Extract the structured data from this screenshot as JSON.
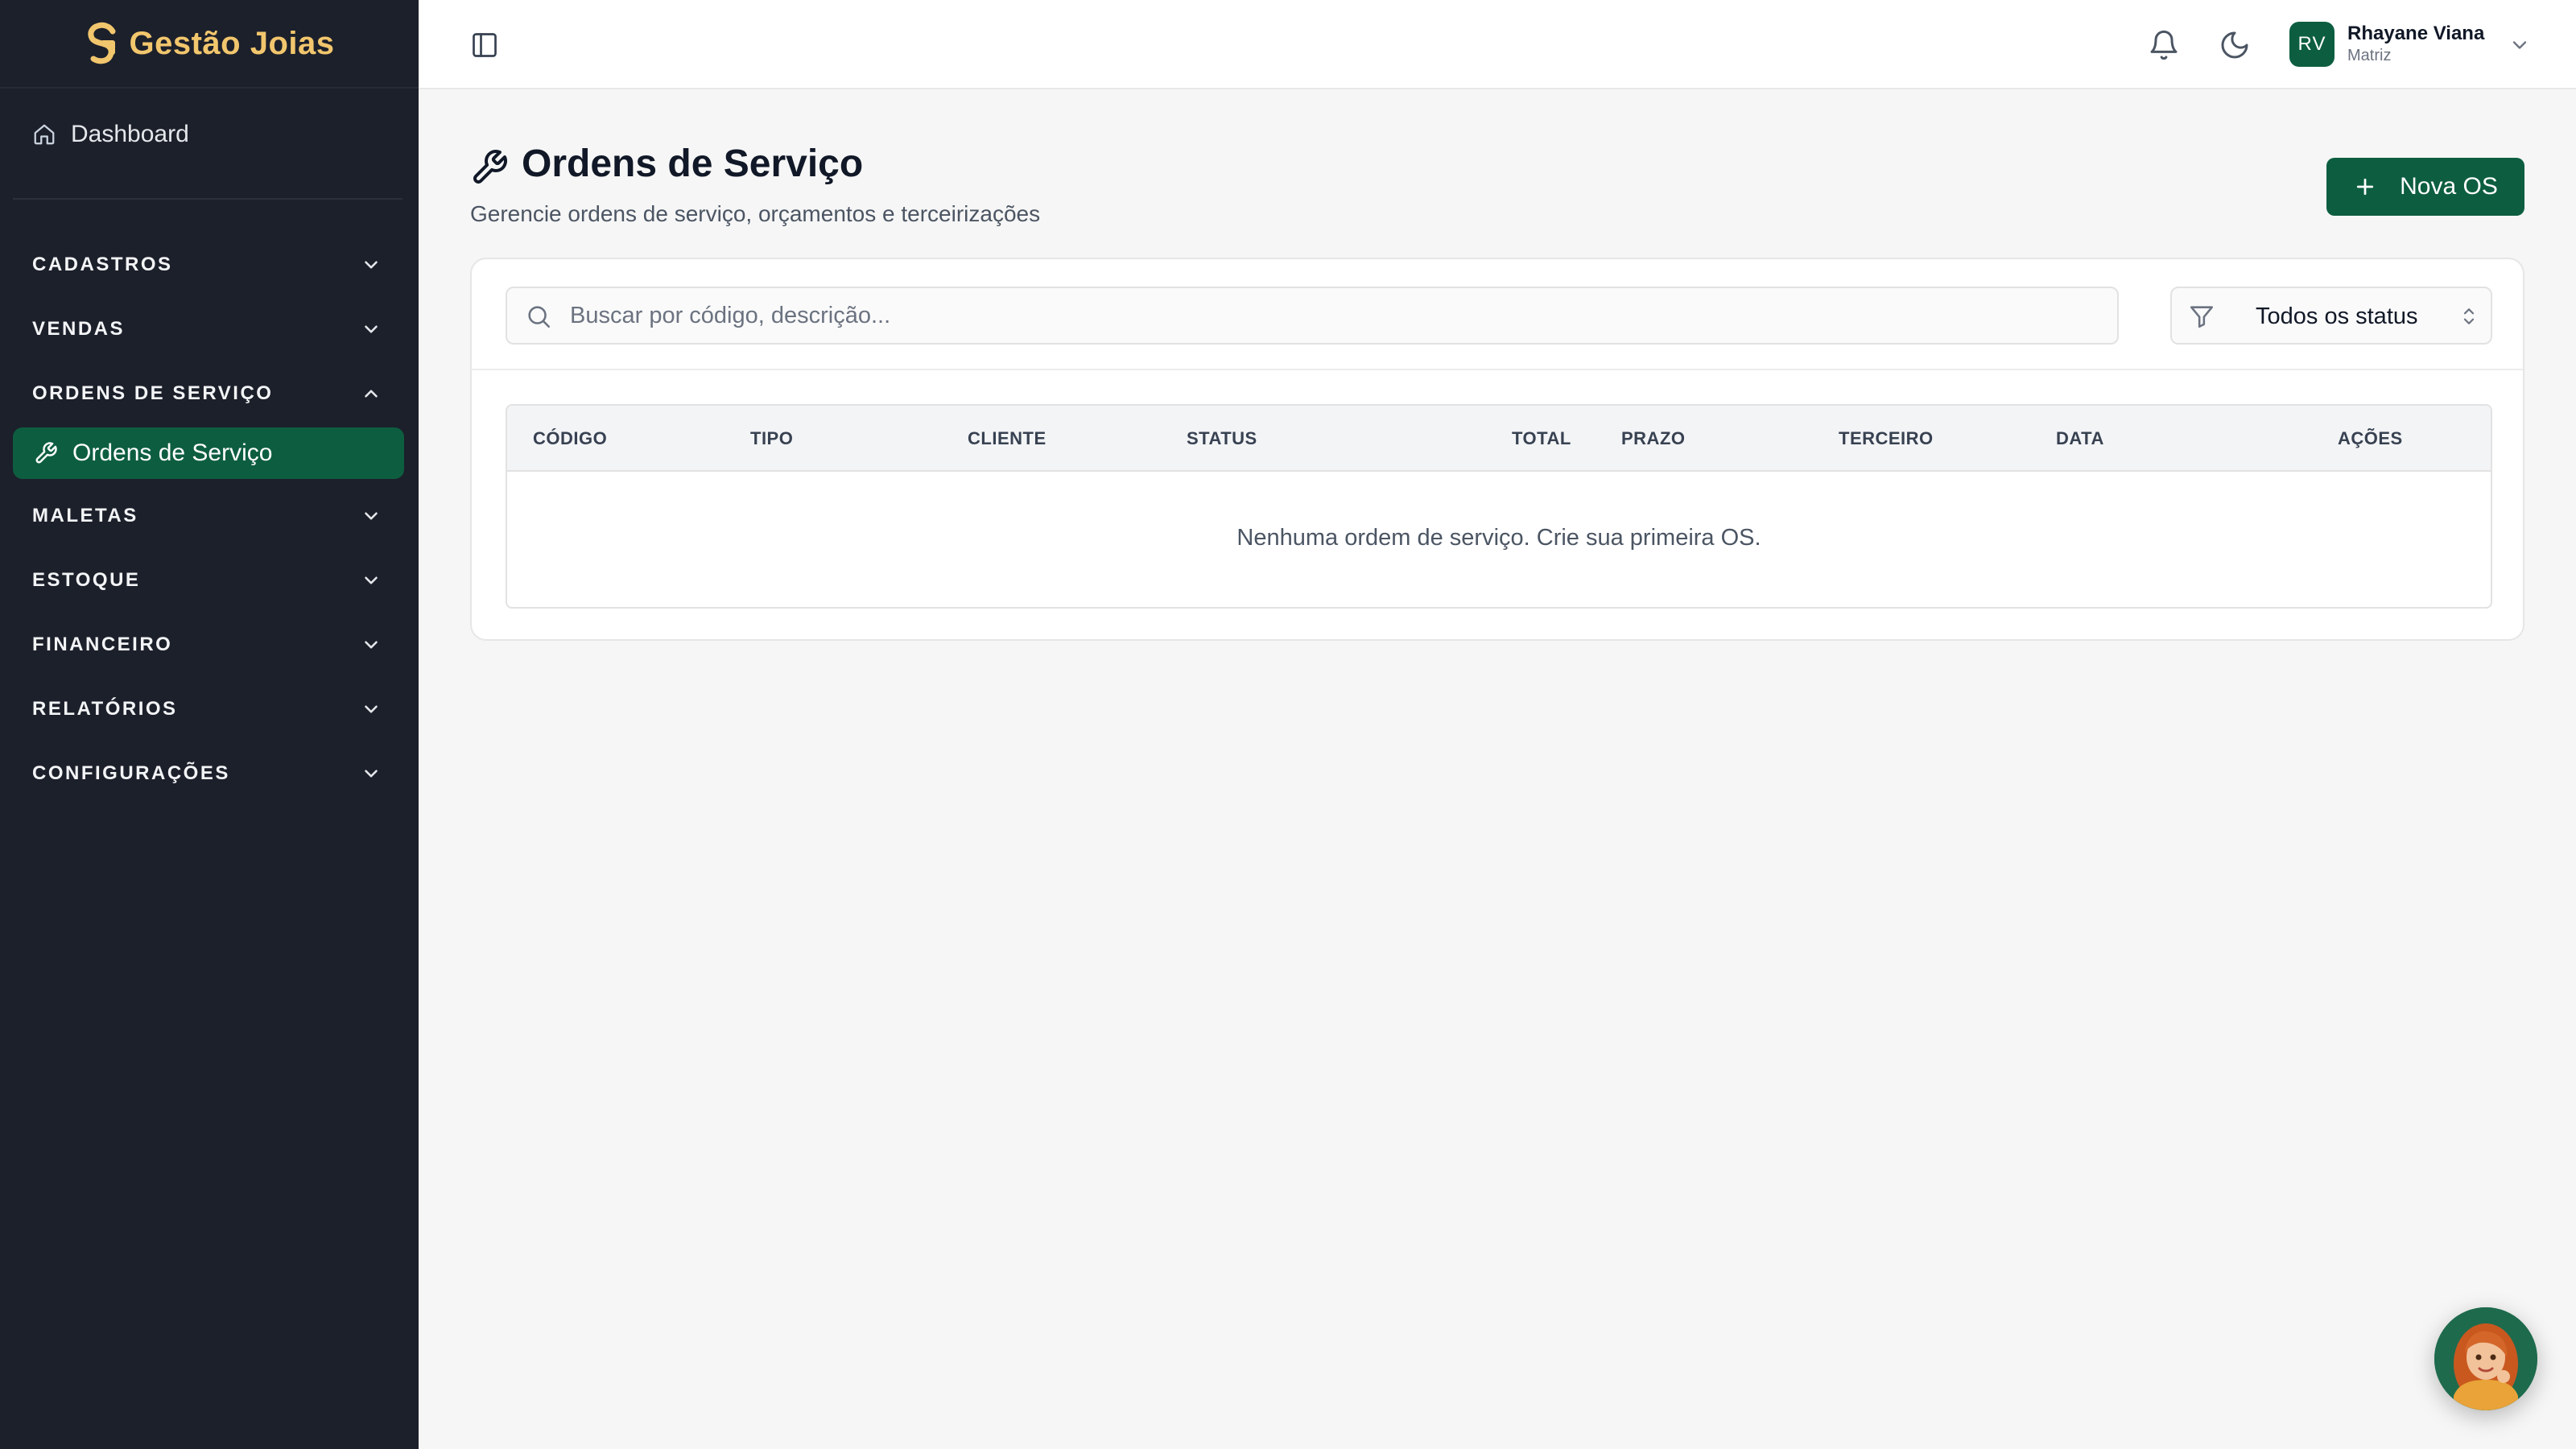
{
  "app": {
    "brand": "Gestão Joias"
  },
  "sidebar": {
    "dashboard": "Dashboard",
    "sections": [
      {
        "label": "CADASTROS",
        "expanded": false
      },
      {
        "label": "VENDAS",
        "expanded": false
      },
      {
        "label": "ORDENS DE SERVIÇO",
        "expanded": true
      },
      {
        "label": "MALETAS",
        "expanded": false
      },
      {
        "label": "ESTOQUE",
        "expanded": false
      },
      {
        "label": "FINANCEIRO",
        "expanded": false
      },
      {
        "label": "RELATÓRIOS",
        "expanded": false
      },
      {
        "label": "CONFIGURAÇÕES",
        "expanded": false
      }
    ],
    "active_item": "Ordens de Serviço"
  },
  "topbar": {
    "avatar_initials": "RV",
    "user_name": "Rhayane Viana",
    "branch": "Matriz"
  },
  "page": {
    "title": "Ordens de Serviço",
    "subtitle": "Gerencie ordens de serviço, orçamentos e terceirizações",
    "new_button": "Nova OS"
  },
  "filters": {
    "search_placeholder": "Buscar por código, descrição...",
    "status_selected": "Todos os status"
  },
  "table": {
    "columns": [
      "CÓDIGO",
      "TIPO",
      "CLIENTE",
      "STATUS",
      "TOTAL",
      "PRAZO",
      "TERCEIRO",
      "DATA",
      "AÇÕES"
    ],
    "rows": [],
    "empty_message": "Nenhuma ordem de serviço. Crie sua primeira OS."
  },
  "colors": {
    "primary": "#0d5e40",
    "sidebar_bg": "#1c202b",
    "brand_gold": "#f2c66d",
    "page_bg": "#f6f6f6"
  },
  "icons": {
    "brand": "brand-logo-icon",
    "dashboard": "home-icon",
    "active_item": "wrench-icon",
    "toggle": "sidebar-toggle-icon",
    "notifications": "bell-icon",
    "theme": "moon-icon",
    "search": "search-icon",
    "filter": "filter-icon",
    "add": "plus-icon"
  }
}
